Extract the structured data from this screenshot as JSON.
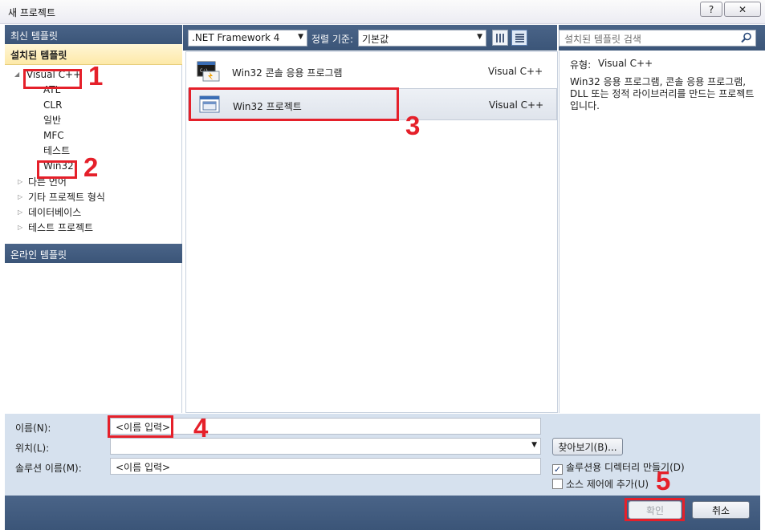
{
  "window": {
    "title": "새 프로젝트",
    "help_label": "?",
    "close_label": "✕"
  },
  "sidebar": {
    "recent_header": "최신 템플릿",
    "installed_header": "설치된 템플릿",
    "online_header": "온라인 템플릿",
    "tree": {
      "visual_cpp": "Visual C++",
      "children": [
        "ATL",
        "CLR",
        "일반",
        "MFC",
        "테스트",
        "Win32"
      ],
      "other_languages": "다른 언어",
      "other_project_types": "기타 프로젝트 형식",
      "database": "데이터베이스",
      "test_projects": "테스트 프로젝트"
    }
  },
  "toolbar": {
    "framework": ".NET Framework 4",
    "sort_label": "정렬 기준:",
    "sort_value": "기본값"
  },
  "templates": [
    {
      "name": "Win32 콘솔 응용 프로그램",
      "lang": "Visual C++",
      "icon": "console-app-icon"
    },
    {
      "name": "Win32 프로젝트",
      "lang": "Visual C++",
      "icon": "win32-project-icon"
    }
  ],
  "search": {
    "placeholder": "설치된 템플릿 검색"
  },
  "details": {
    "type_label": "유형:",
    "type_value": "Visual C++",
    "description": "Win32 응용 프로그램, 콘솔 응용 프로그램, DLL 또는 정적 라이브러리를 만드는 프로젝트입니다."
  },
  "form": {
    "name_label": "이름(N):",
    "name_value": "<이름 입력>",
    "location_label": "위치(L):",
    "location_value": "",
    "solution_label": "솔루션 이름(M):",
    "solution_value": "<이름 입력>",
    "browse_label": "찾아보기(B)...",
    "create_dir_label": "솔루션용 디렉터리 만들기(D)",
    "source_control_label": "소스 제어에 추가(U)"
  },
  "buttons": {
    "ok": "확인",
    "cancel": "취소"
  },
  "annotations": [
    "1",
    "2",
    "3",
    "4",
    "5"
  ],
  "colors": {
    "annotation_red": "#e5202a",
    "header_blue": "#3b5578",
    "installed_highlight": "#fde9a8"
  }
}
